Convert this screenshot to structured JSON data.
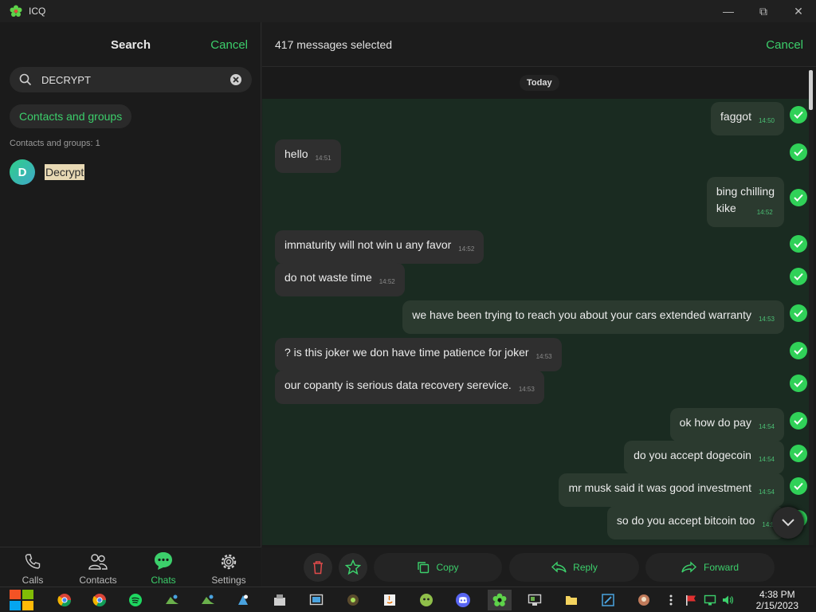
{
  "window": {
    "title": "ICQ",
    "minimize": "—",
    "maximize": "⧉",
    "close": "✕"
  },
  "left": {
    "header_title": "Search",
    "cancel_label": "Cancel",
    "search_value": "DECRYPT",
    "filter_chip": "Contacts and groups",
    "results_count": "Contacts and groups: 1",
    "contact": {
      "initial": "D",
      "name": "Decrypt"
    }
  },
  "nav": {
    "calls": "Calls",
    "contacts": "Contacts",
    "chats": "Chats",
    "settings": "Settings"
  },
  "right": {
    "selected_label": "417 messages selected",
    "cancel_label": "Cancel",
    "date_separator": "Today"
  },
  "messages": [
    {
      "dir": "out",
      "text": "faggot",
      "time": "14:50"
    },
    {
      "dir": "in",
      "text": "hello",
      "time": "14:51"
    },
    {
      "dir": "out",
      "text": "bing chilling",
      "text2": "kike",
      "time": "14:52"
    },
    {
      "dir": "in",
      "text": "immaturity will not win u any favor",
      "time": "14:52"
    },
    {
      "dir": "in",
      "text": "do not waste time",
      "time": "14:52"
    },
    {
      "dir": "out",
      "text": "we have been trying to reach you about your cars extended warranty",
      "time": "14:53"
    },
    {
      "dir": "in",
      "text": "? is this joker we don have time patience for joker",
      "time": "14:53"
    },
    {
      "dir": "in",
      "text": "our copanty is serious data recovery serevice.",
      "time": "14:53"
    },
    {
      "dir": "out",
      "text": "ok how do pay",
      "time": "14:54"
    },
    {
      "dir": "out",
      "text": "do you accept dogecoin",
      "time": "14:54"
    },
    {
      "dir": "out",
      "text": "mr musk said it was good investment",
      "time": "14:54"
    },
    {
      "dir": "out",
      "text": "so do you accept bitcoin too",
      "time": "14:5"
    }
  ],
  "actions": {
    "copy": "Copy",
    "reply": "Reply",
    "forward": "Forward"
  },
  "taskbar": {
    "time": "4:38 PM",
    "date": "2/15/2023"
  },
  "colors": {
    "accent": "#3ccf6b",
    "chat_bg": "#1a2b21",
    "check": "#30d158"
  }
}
